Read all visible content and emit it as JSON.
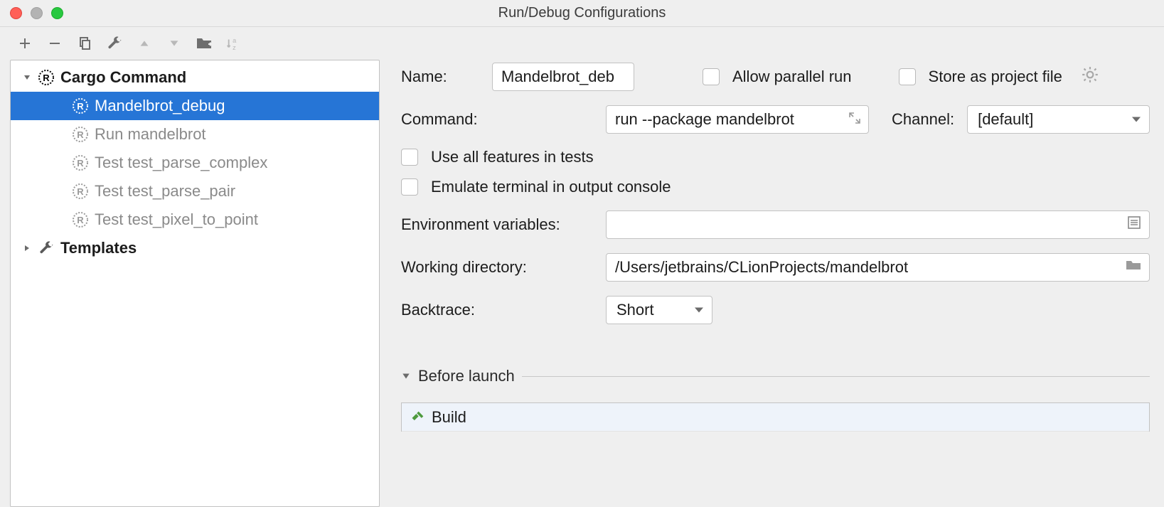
{
  "window": {
    "title": "Run/Debug Configurations"
  },
  "toolbar": {
    "add": "plus-icon",
    "remove": "minus-icon",
    "copy": "copy-icon",
    "edit_defaults": "wrench-icon",
    "up": "arrow-up-icon",
    "down": "arrow-down-icon",
    "folder": "folder-move-icon",
    "sort_az": "sort-alpha-icon"
  },
  "tree": {
    "groups": [
      {
        "name": "Cargo Command",
        "expanded": true,
        "icon": "rust-icon",
        "items": [
          {
            "label": "Mandelbrot_debug",
            "selected": true,
            "dim": false
          },
          {
            "label": "Run mandelbrot",
            "selected": false,
            "dim": true
          },
          {
            "label": "Test test_parse_complex",
            "selected": false,
            "dim": true
          },
          {
            "label": "Test test_parse_pair",
            "selected": false,
            "dim": true
          },
          {
            "label": "Test test_pixel_to_point",
            "selected": false,
            "dim": true
          }
        ]
      },
      {
        "name": "Templates",
        "expanded": false,
        "icon": "wrench-icon",
        "items": []
      }
    ]
  },
  "form": {
    "name_label": "Name:",
    "name_value": "Mandelbrot_deb",
    "allow_parallel_label": "Allow parallel run",
    "allow_parallel_checked": false,
    "store_project_label": "Store as project file",
    "store_project_checked": false,
    "command_label": "Command:",
    "command_value": "run --package mandelbrot",
    "channel_label": "Channel:",
    "channel_value": "[default]",
    "use_all_features_label": "Use all features in tests",
    "use_all_features_checked": false,
    "emulate_terminal_label": "Emulate terminal in output console",
    "emulate_terminal_checked": false,
    "env_label": "Environment variables:",
    "env_value": "",
    "workdir_label": "Working directory:",
    "workdir_value": "/Users/jetbrains/CLionProjects/mandelbrot",
    "backtrace_label": "Backtrace:",
    "backtrace_value": "Short",
    "before_launch_label": "Before launch",
    "before_launch_items": [
      {
        "label": "Build",
        "icon": "hammer-icon"
      }
    ]
  }
}
